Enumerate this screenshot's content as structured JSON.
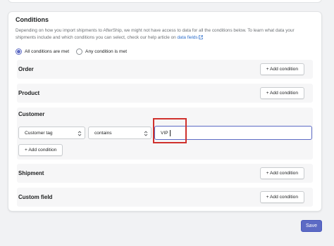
{
  "conditions": {
    "title": "Conditions",
    "description_prefix": "Depending on how you import shipments to AfterShip, we might not have access to data for all the conditions below. To learn what data your shipments include and which conditions you can select, check our help article on ",
    "description_link": "data fields",
    "match_options": [
      {
        "label": "All conditions are met",
        "selected": true
      },
      {
        "label": "Any condition is met",
        "selected": false
      }
    ]
  },
  "sections": {
    "order": {
      "title": "Order",
      "add_label": "+ Add condition"
    },
    "product": {
      "title": "Product",
      "add_label": "+ Add condition"
    },
    "customer": {
      "title": "Customer",
      "add_label": "+ Add condition",
      "field_select": "Customer tag",
      "operator_select": "contains",
      "value": "VIP"
    },
    "shipment": {
      "title": "Shipment",
      "add_label": "+ Add condition"
    },
    "custom_field": {
      "title": "Custom field",
      "add_label": "+ Add condition"
    }
  },
  "footer": {
    "save_label": "Save"
  },
  "colors": {
    "accent": "#5c6ac4",
    "highlight": "#d0312d",
    "link": "#2c6ecb"
  },
  "icons": [
    "external-link-icon",
    "select-caret-icon",
    "radio-icon"
  ]
}
